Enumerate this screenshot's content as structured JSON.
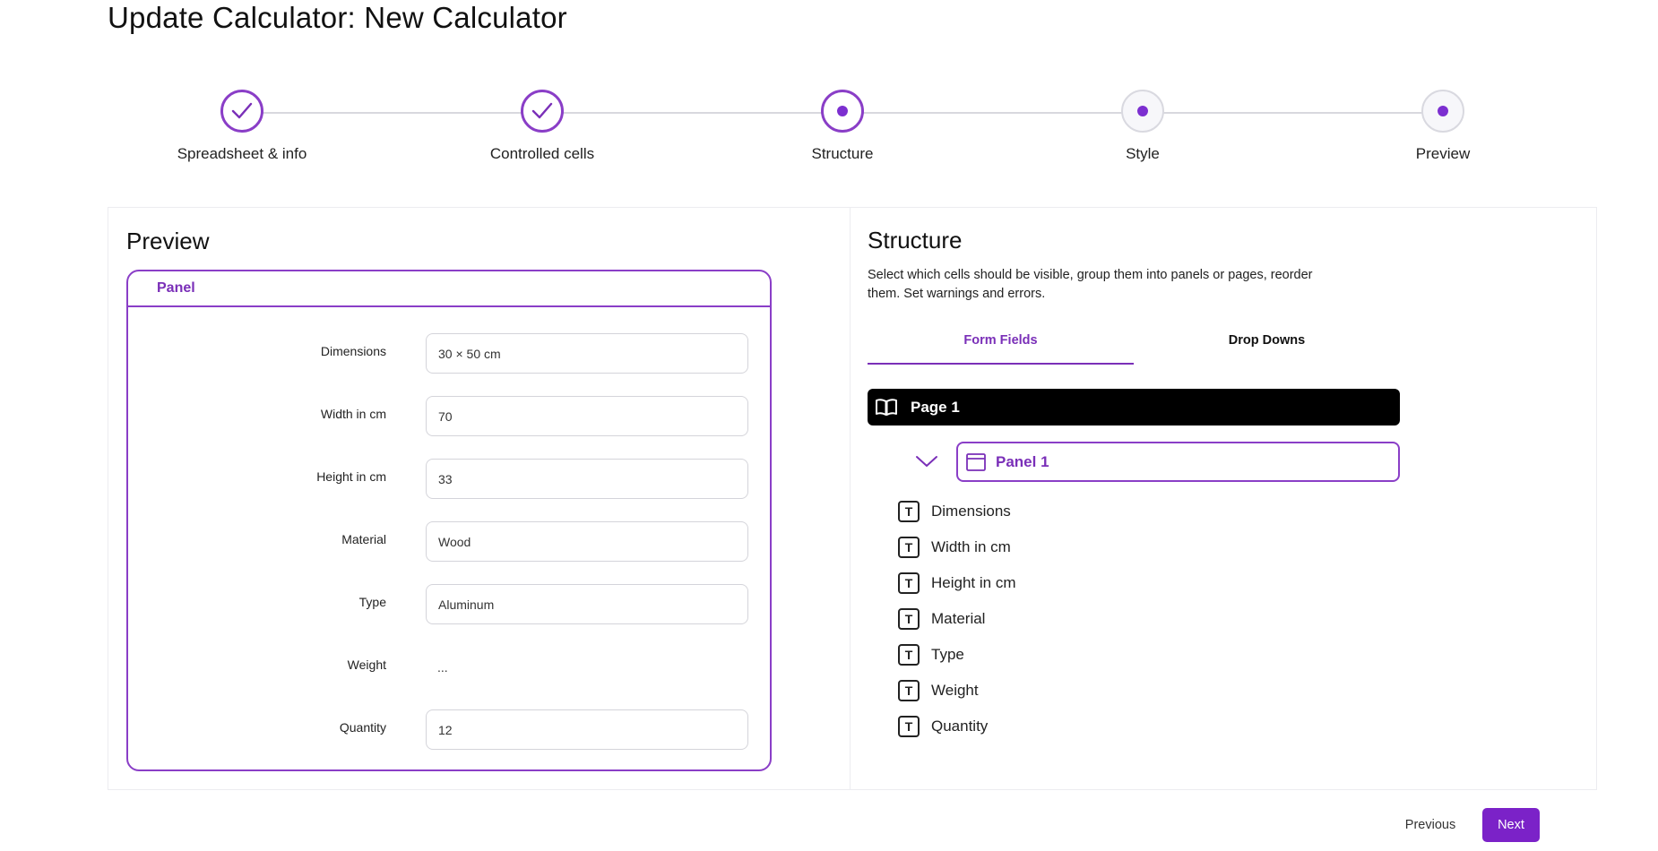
{
  "page": {
    "title": "Update Calculator: New Calculator"
  },
  "stepper": {
    "steps": [
      {
        "label": "Spreadsheet & info",
        "state": "done"
      },
      {
        "label": "Controlled cells",
        "state": "done"
      },
      {
        "label": "Structure",
        "state": "current"
      },
      {
        "label": "Style",
        "state": "upcoming"
      },
      {
        "label": "Preview",
        "state": "upcoming"
      }
    ]
  },
  "preview": {
    "title": "Preview",
    "panel_title": "Panel",
    "fields": [
      {
        "label": "Dimensions",
        "value": "30 × 50 cm",
        "kind": "input"
      },
      {
        "label": "Width in cm",
        "value": "70",
        "kind": "input"
      },
      {
        "label": "Height in cm",
        "value": "33",
        "kind": "input"
      },
      {
        "label": "Material",
        "value": "Wood",
        "kind": "input"
      },
      {
        "label": "Type",
        "value": "Aluminum",
        "kind": "input"
      },
      {
        "label": "Weight",
        "value": "...",
        "kind": "text"
      },
      {
        "label": "Quantity",
        "value": "12",
        "kind": "input"
      }
    ]
  },
  "structure": {
    "title": "Structure",
    "description": "Select which cells should be visible, group them into panels or pages, reorder them. Set warnings and errors.",
    "tabs": [
      {
        "label": "Form Fields",
        "active": true
      },
      {
        "label": "Drop Downs",
        "active": false
      }
    ],
    "page_label": "Page 1",
    "panel_label": "Panel 1",
    "items": [
      "Dimensions",
      "Width in cm",
      "Height in cm",
      "Material",
      "Type",
      "Weight",
      "Quantity"
    ],
    "item_icon_glyph": "T",
    "icons": {
      "page": "book-open-icon",
      "panel": "panel-window-icon",
      "collapse": "chevron-down-icon",
      "item": "text-field-icon"
    }
  },
  "footer": {
    "previous_label": "Previous",
    "next_label": "Next"
  },
  "colors": {
    "accent": "#7b22c8",
    "accent_border": "#8a3ec7",
    "page_bar": "#000000"
  }
}
